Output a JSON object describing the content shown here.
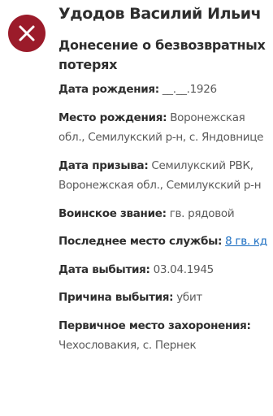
{
  "icon": {
    "name": "close-icon",
    "bg": "#9b1b2a"
  },
  "person": {
    "name": "Удодов Василий Ильич"
  },
  "document": {
    "type": "Донесение о безвозвратных потерях"
  },
  "fields": {
    "birth_date": {
      "label": "Дата рождения:",
      "value": "__.__.1926"
    },
    "birth_place": {
      "label": "Место рождения:",
      "value": "Воронежская обл., Семилукский р-н, с. Яндовнице"
    },
    "draft_date": {
      "label": "Дата призыва:",
      "value": "Семилукский РВК, Воронежская обл., Семилукский р-н"
    },
    "rank": {
      "label": "Воинское звание:",
      "value": "гв. рядовой"
    },
    "last_unit": {
      "label": "Последнее место службы:",
      "value": "8 гв. кд"
    },
    "departure_date": {
      "label": "Дата выбытия:",
      "value": "03.04.1945"
    },
    "departure_reason": {
      "label": "Причина выбытия:",
      "value": "убит"
    },
    "burial": {
      "label": "Первичное место захоронения:",
      "value": "Чехословакия, с. Пернек"
    }
  },
  "colors": {
    "link": "#1b6ec2",
    "accent": "#9b1b2a"
  }
}
